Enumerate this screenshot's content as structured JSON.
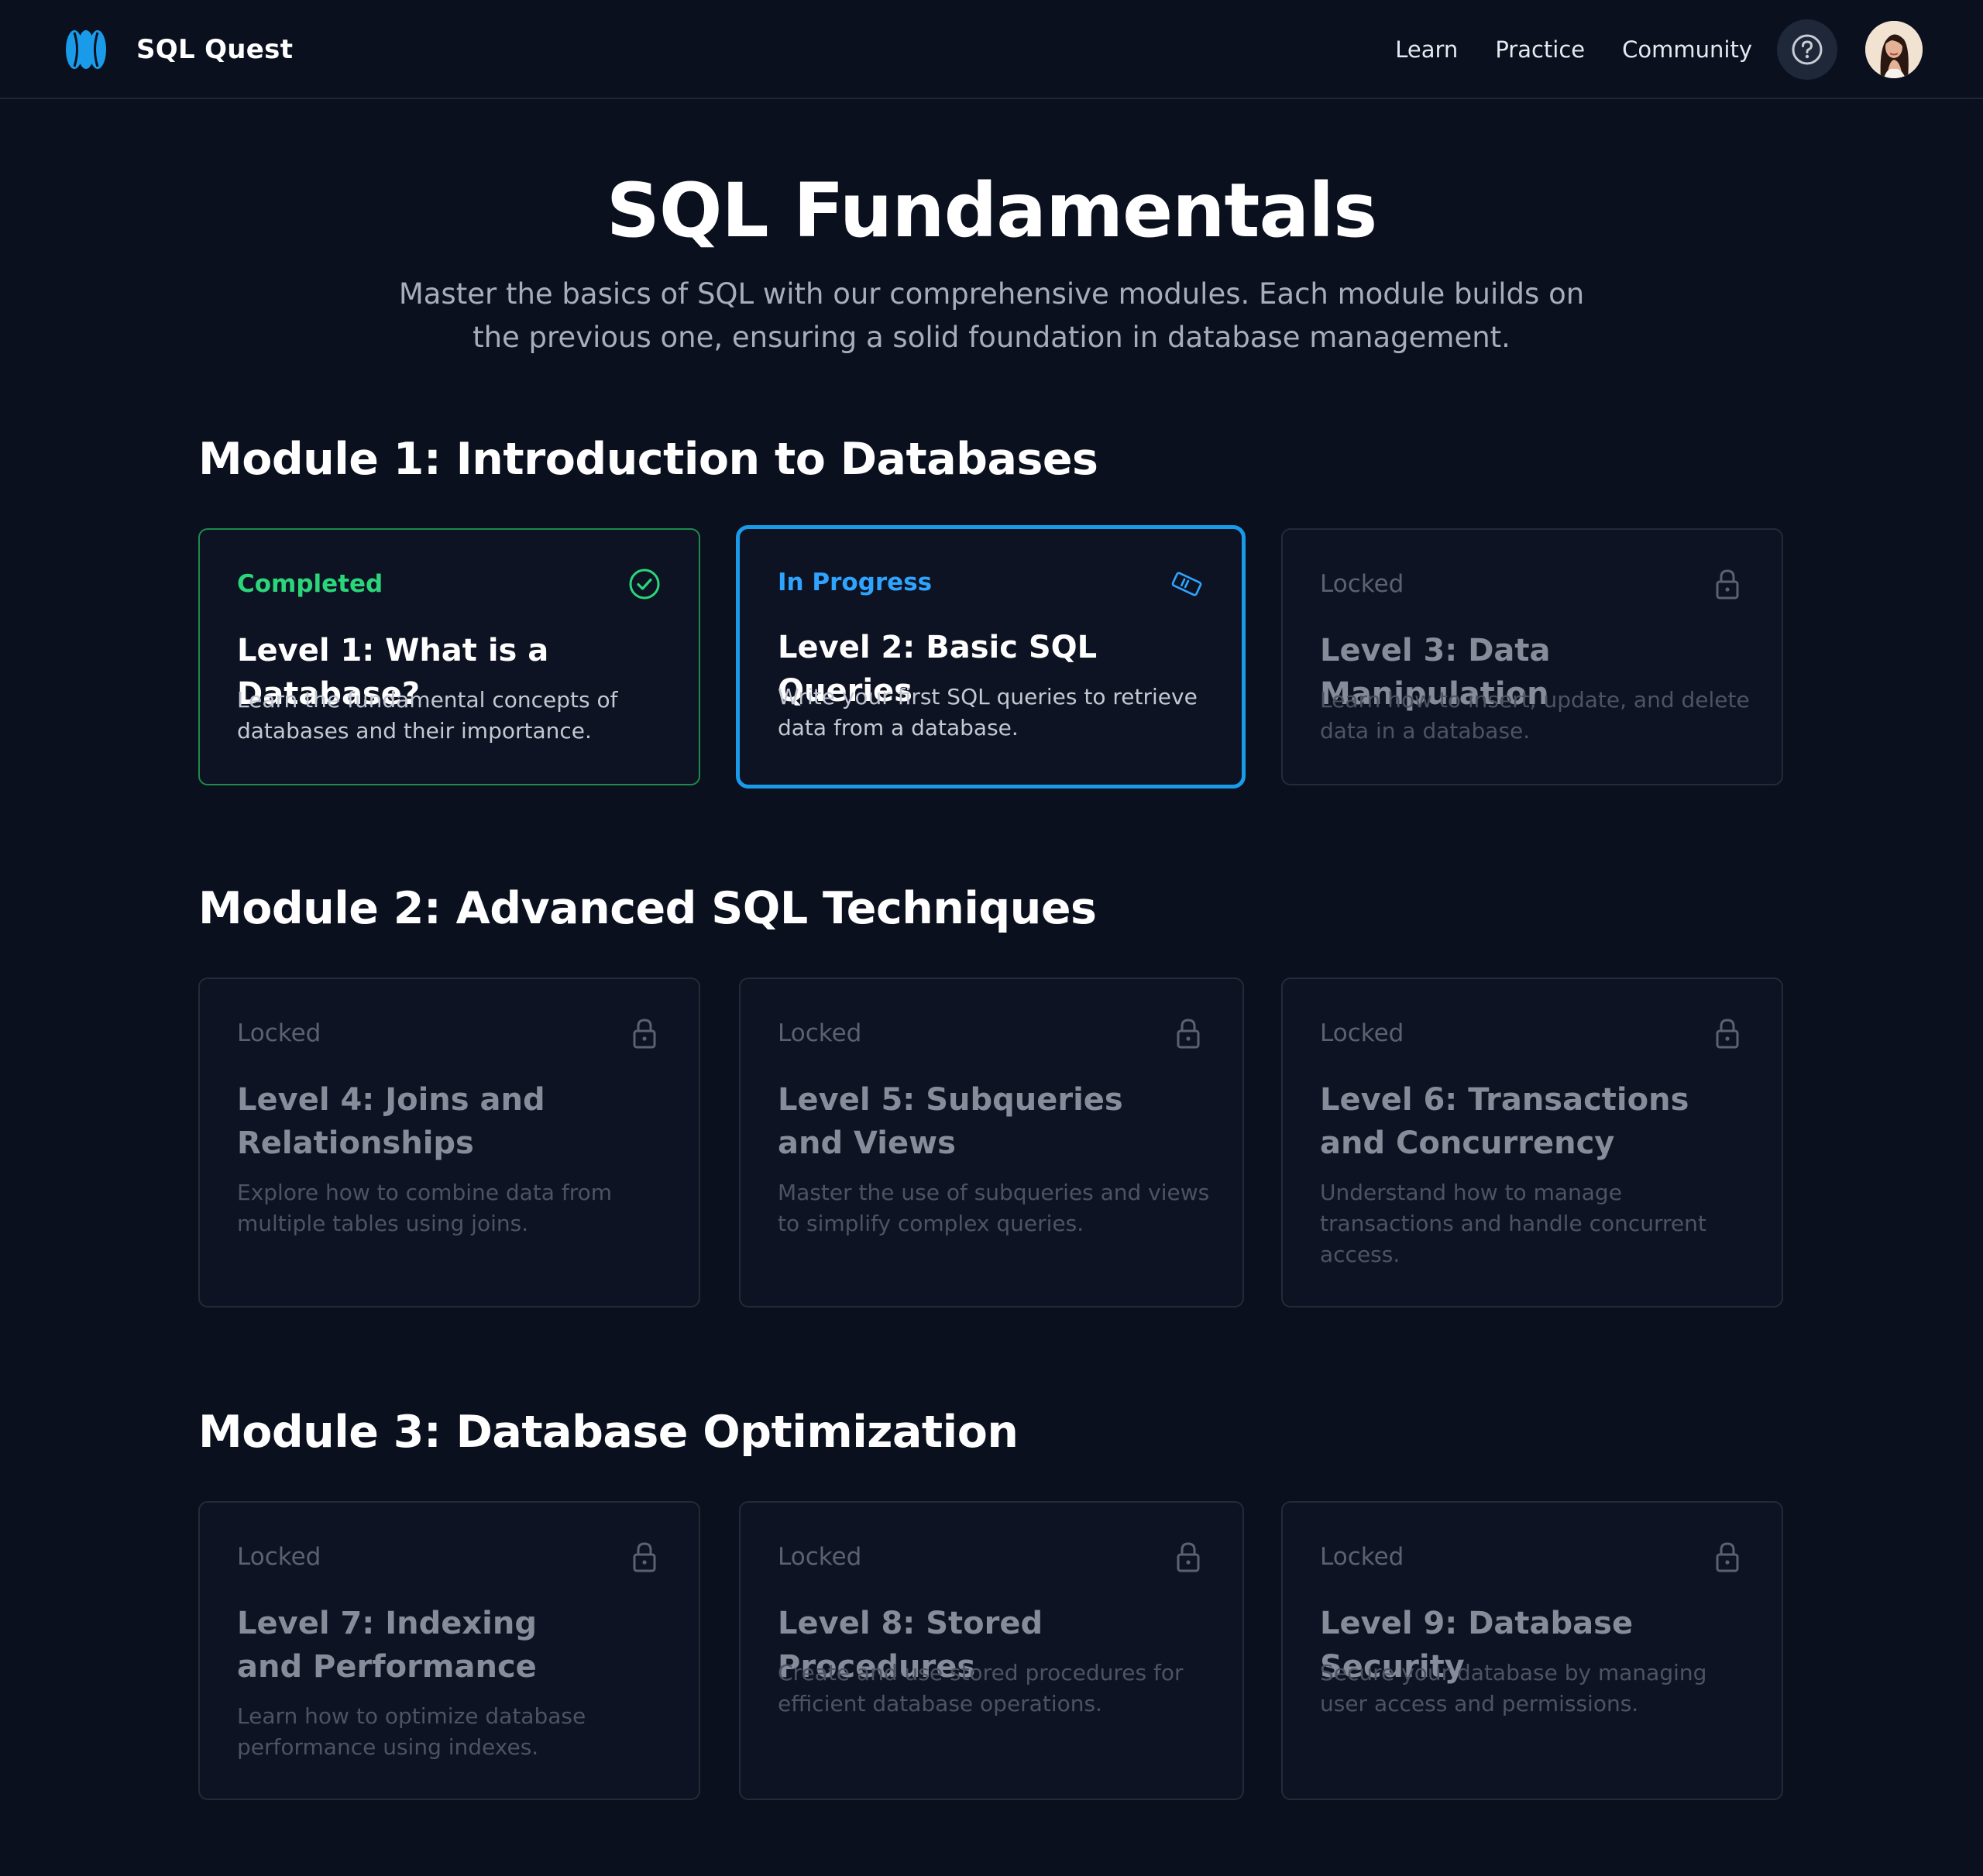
{
  "app": {
    "name": "SQL Quest"
  },
  "nav": {
    "links": [
      "Learn",
      "Practice",
      "Community"
    ],
    "help_icon": "question-circle-icon",
    "avatar_label": "user avatar"
  },
  "hero": {
    "title": "SQL Fundamentals",
    "subtitle": "Master the basics of SQL with our comprehensive modules. Each module builds on the previous one, ensuring a solid foundation in database management."
  },
  "modules": [
    {
      "title": "Module 1: Introduction to Databases",
      "levels": [
        {
          "status": "Completed",
          "state": "completed",
          "icon": "check-circle-icon",
          "title": "Level 1: What is a Database?",
          "description": "Learn the fundamental concepts of databases and their importance."
        },
        {
          "status": "In Progress",
          "state": "progress",
          "icon": "ticket-icon",
          "title": "Level 2: Basic SQL Queries",
          "description": "Write your first SQL queries to retrieve data from a database."
        },
        {
          "status": "Locked",
          "state": "locked",
          "icon": "lock-icon",
          "title": "Level 3: Data Manipulation",
          "description": "Learn how to insert, update, and delete data in a database."
        }
      ]
    },
    {
      "title": "Module 2: Advanced SQL Techniques",
      "levels": [
        {
          "status": "Locked",
          "state": "locked",
          "icon": "lock-icon",
          "title": "Level 4: Joins and Relationships",
          "description": "Explore how to combine data from multiple tables using joins."
        },
        {
          "status": "Locked",
          "state": "locked",
          "icon": "lock-icon",
          "title": "Level 5: Subqueries and Views",
          "description": "Master the use of subqueries and views to simplify complex queries."
        },
        {
          "status": "Locked",
          "state": "locked",
          "icon": "lock-icon",
          "title": "Level 6: Transactions and Concurrency",
          "description": "Understand how to manage transactions and handle concurrent access."
        }
      ]
    },
    {
      "title": "Module 3: Database Optimization",
      "levels": [
        {
          "status": "Locked",
          "state": "locked",
          "icon": "lock-icon",
          "title": "Level 7: Indexing and Performance",
          "description": "Learn how to optimize database performance using indexes."
        },
        {
          "status": "Locked",
          "state": "locked",
          "icon": "lock-icon",
          "title": "Level 8: Stored Procedures",
          "description": "Create and use stored procedures for efficient database operations."
        },
        {
          "status": "Locked",
          "state": "locked",
          "icon": "lock-icon",
          "title": "Level 9: Database Security",
          "description": "Secure your database by managing user access and permissions."
        }
      ]
    }
  ],
  "colors": {
    "background": "#0a101e",
    "completed": "#2bd67b",
    "in_progress": "#2fa4ff",
    "locked": "#5a6272",
    "brand": "#1a9bea"
  }
}
